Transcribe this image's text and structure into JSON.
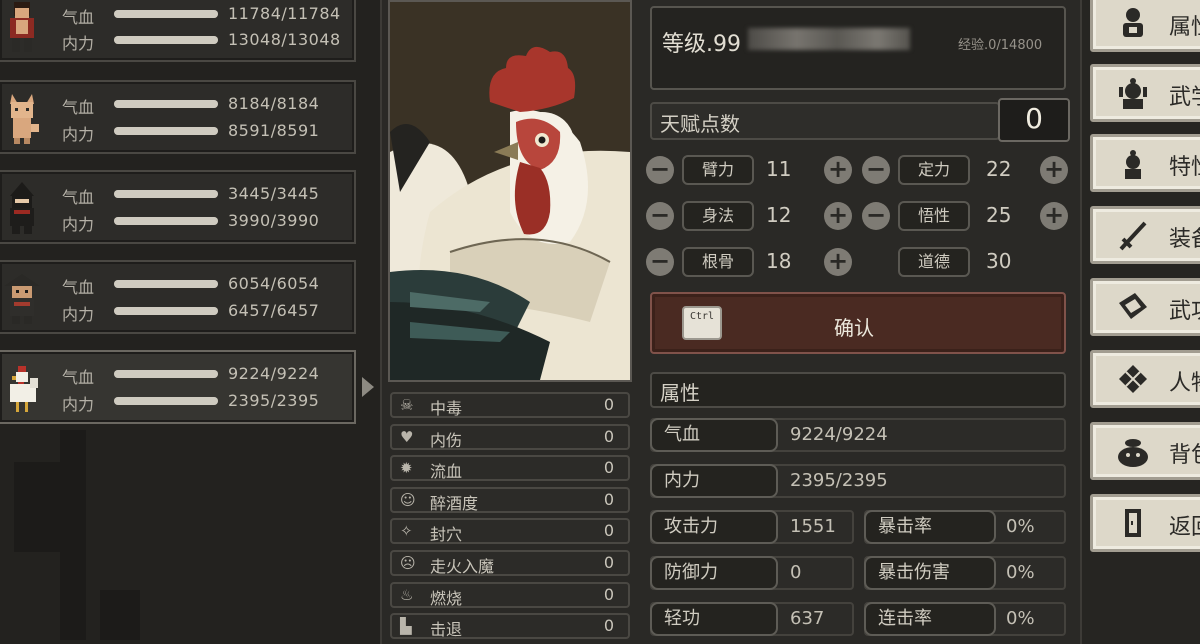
{
  "party": [
    {
      "hp": "11784/11784",
      "mp": "13048/13048",
      "hp_frac": 1,
      "mp_frac": 1
    },
    {
      "hp": "8184/8184",
      "mp": "8591/8591",
      "hp_frac": 1,
      "mp_frac": 1
    },
    {
      "hp": "3445/3445",
      "mp": "3990/3990",
      "hp_frac": 1,
      "mp_frac": 1
    },
    {
      "hp": "6054/6054",
      "mp": "6457/6457",
      "hp_frac": 1,
      "mp_frac": 1
    },
    {
      "hp": "9224/9224",
      "mp": "2395/2395",
      "hp_frac": 1,
      "mp_frac": 1
    }
  ],
  "labels": {
    "hp": "气血",
    "mp": "内力"
  },
  "status_effects": [
    {
      "name": "中毒",
      "value": "0",
      "icon": "skull-icon"
    },
    {
      "name": "内伤",
      "value": "0",
      "icon": "broken-heart-icon"
    },
    {
      "name": "流血",
      "value": "0",
      "icon": "blood-splat-icon"
    },
    {
      "name": "醉酒度",
      "value": "0",
      "icon": "drunk-face-icon"
    },
    {
      "name": "封穴",
      "value": "0",
      "icon": "acupoint-icon"
    },
    {
      "name": "走火入魔",
      "value": "0",
      "icon": "demon-face-icon"
    },
    {
      "name": "燃烧",
      "value": "0",
      "icon": "flame-icon"
    },
    {
      "name": "击退",
      "value": "0",
      "icon": "boot-icon"
    }
  ],
  "level": {
    "text": "等级.99",
    "exp": "经验.0/14800"
  },
  "talent": {
    "label": "天赋点数",
    "value": "0"
  },
  "attributes": {
    "bili": {
      "label": "臂力",
      "value": "11"
    },
    "dingli": {
      "label": "定力",
      "value": "22"
    },
    "shenfa": {
      "label": "身法",
      "value": "12"
    },
    "wuxing": {
      "label": "悟性",
      "value": "25"
    },
    "gengu": {
      "label": "根骨",
      "value": "18"
    },
    "daode": {
      "label": "道德",
      "value": "30"
    }
  },
  "confirm": {
    "key": "Ctrl",
    "label": "确认"
  },
  "properties": {
    "title": "属性",
    "hp": {
      "label": "气血",
      "value": "9224/9224"
    },
    "mp": {
      "label": "内力",
      "value": "2395/2395"
    },
    "attack": {
      "label": "攻击力",
      "value": "1551"
    },
    "crit_rate": {
      "label": "暴击率",
      "value": "0%"
    },
    "defense": {
      "label": "防御力",
      "value": "0"
    },
    "crit_dmg": {
      "label": "暴击伤害",
      "value": "0%"
    },
    "qinggong": {
      "label": "轻功",
      "value": "637"
    },
    "combo_rate": {
      "label": "连击率",
      "value": "0%"
    }
  },
  "menu": [
    {
      "label": "属性",
      "icon": "person-icon"
    },
    {
      "label": "武学",
      "icon": "martial-arts-icon"
    },
    {
      "label": "特性",
      "icon": "trait-icon"
    },
    {
      "label": "装备",
      "icon": "sword-icon"
    },
    {
      "label": "武功",
      "icon": "book-icon"
    },
    {
      "label": "人物",
      "icon": "grid-scroll-icon"
    },
    {
      "label": "背包",
      "icon": "bag-icon"
    },
    {
      "label": "返回",
      "icon": "door-icon"
    }
  ]
}
